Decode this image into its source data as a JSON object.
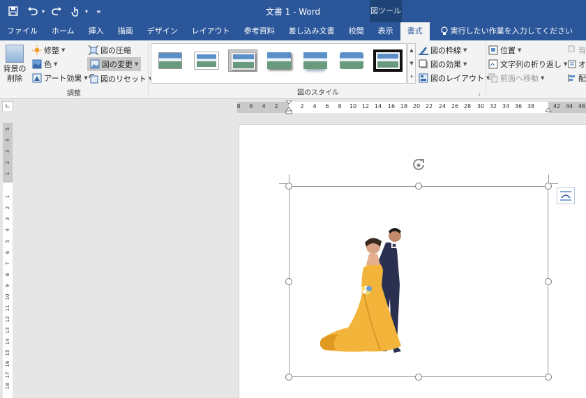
{
  "window": {
    "doc_title": "文書 1  -  Word",
    "context_tab_group": "図ツール"
  },
  "quick_access": {
    "save_icon": "save-icon",
    "undo_icon": "undo-icon",
    "redo_icon": "redo-icon",
    "touch_icon": "touch-mode-icon",
    "customize_icon": "customize-qat-icon"
  },
  "tabs": [
    "ファイル",
    "ホーム",
    "挿入",
    "描画",
    "デザイン",
    "レイアウト",
    "参考資料",
    "差し込み文書",
    "校閲",
    "表示",
    "書式"
  ],
  "active_tab": "書式",
  "tell_me": "実行したい作業を入力してください",
  "ribbon": {
    "adjust": {
      "remove_bg": [
        "背景の",
        "削除"
      ],
      "corrections": "修整",
      "color": "色",
      "art_effects": "アート効果",
      "compress": "図の圧縮",
      "change": "図の変更",
      "reset": "図のリセット",
      "label": "調整"
    },
    "styles": {
      "label": "図のスタイル",
      "border": "図の枠線",
      "effects": "図の効果",
      "layout": "図のレイアウト"
    },
    "arrange": {
      "position": "位置",
      "wrap_text": "文字列の折り返し",
      "bring_forward": "前面へ移動",
      "send_backward": "背",
      "objects": "オ",
      "align": "配"
    }
  },
  "ruler": {
    "h_left": [
      "8",
      "6",
      "4",
      "2"
    ],
    "h_right": [
      "2",
      "4",
      "6",
      "8",
      "10",
      "12",
      "14",
      "16",
      "18",
      "20",
      "22",
      "24",
      "26",
      "28",
      "30",
      "32",
      "34",
      "36",
      "38"
    ],
    "h_far": [
      "42",
      "44",
      "46"
    ],
    "v_top": [
      "5",
      "4",
      "3",
      "2",
      "1"
    ],
    "v_bottom": [
      "1",
      "2",
      "3",
      "4",
      "5",
      "6",
      "7",
      "8",
      "9",
      "10",
      "11",
      "12",
      "13",
      "14",
      "15",
      "16",
      "17",
      "18",
      "19"
    ]
  },
  "colors": {
    "title_bar": "#2b579a",
    "dress": "#f2b43a",
    "suit": "#2a3150"
  }
}
